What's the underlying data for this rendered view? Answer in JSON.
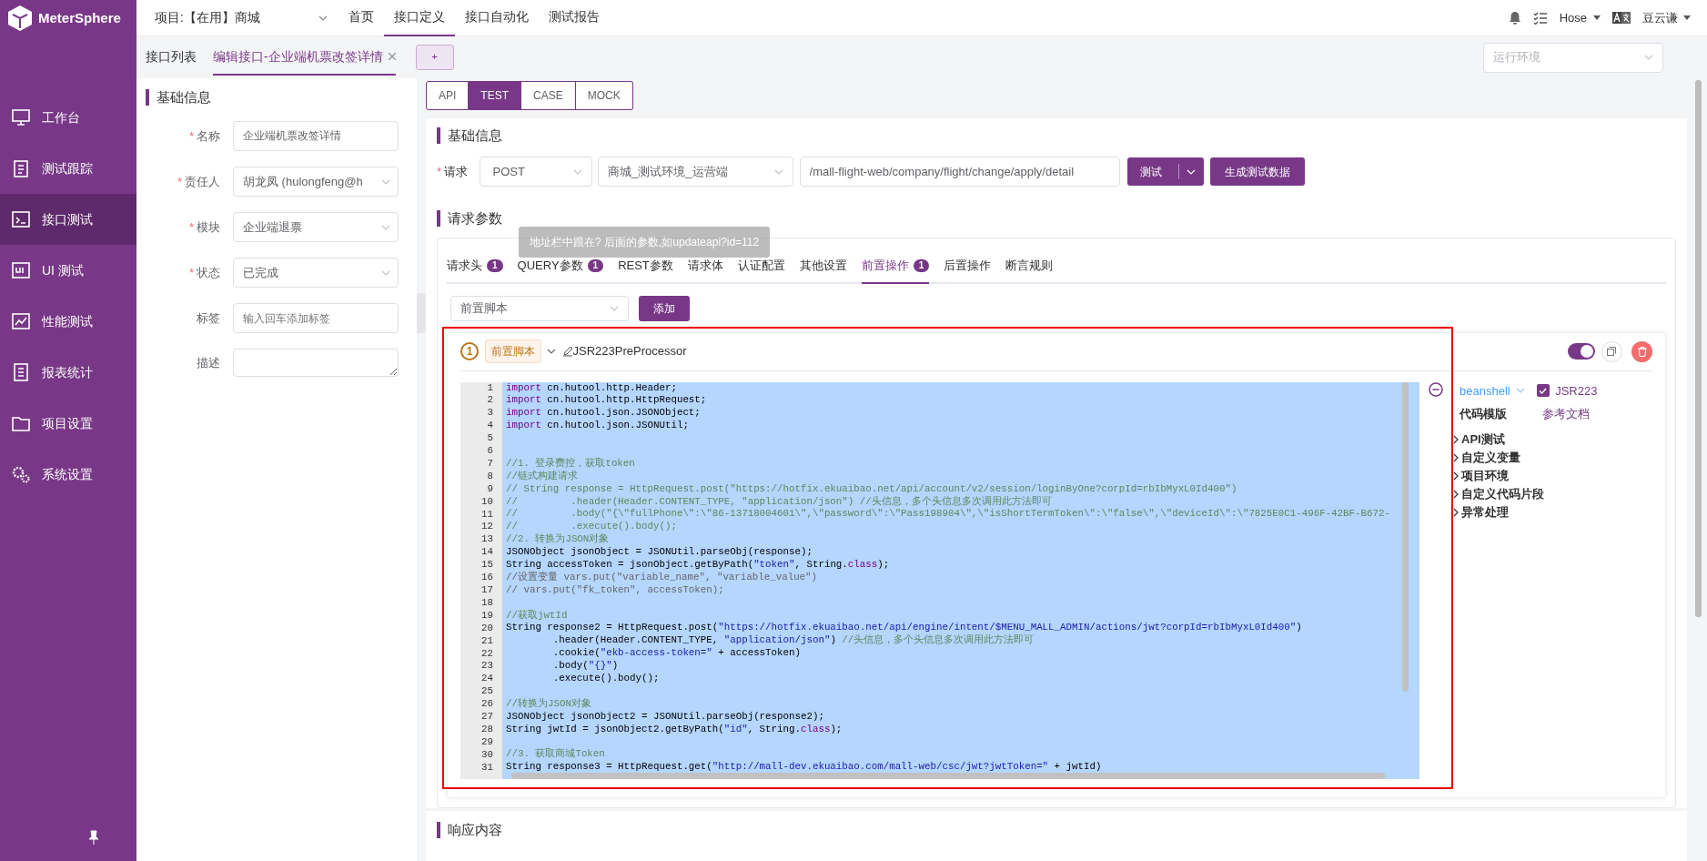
{
  "brand": "MeterSphere",
  "sidebar": {
    "items": [
      {
        "label": "工作台",
        "selected": false
      },
      {
        "label": "测试跟踪",
        "selected": false
      },
      {
        "label": "接口测试",
        "selected": true
      },
      {
        "label": "UI 测试",
        "selected": false
      },
      {
        "label": "性能测试",
        "selected": false
      },
      {
        "label": "报表统计",
        "selected": false
      },
      {
        "label": "项目设置",
        "selected": false
      },
      {
        "label": "系统设置",
        "selected": false
      }
    ]
  },
  "topbar": {
    "project": "项目:【在用】商城",
    "nav": [
      {
        "label": "首页",
        "selected": false
      },
      {
        "label": "接口定义",
        "selected": true
      },
      {
        "label": "接口自动化",
        "selected": false
      },
      {
        "label": "测试报告",
        "selected": false
      }
    ],
    "workspace": "Hose",
    "user": "豆云谦"
  },
  "tabs": [
    {
      "label": "接口列表",
      "selected": false,
      "closable": false
    },
    {
      "label": "编辑接口-企业端机票改签详情",
      "selected": true,
      "closable": true
    }
  ],
  "add_tab": "+",
  "environment": {
    "placeholder": "运行环境"
  },
  "basic_info": {
    "title": "基础信息",
    "fields": [
      {
        "label": "名称",
        "required_mark": "*",
        "kind": "input",
        "value": "企业端机票改签详情"
      },
      {
        "label": "责任人",
        "required_mark": "*",
        "kind": "select",
        "value": "胡龙凤 (hulongfeng@h"
      },
      {
        "label": "模块",
        "required_mark": "*",
        "kind": "select",
        "value": "企业端退票"
      },
      {
        "label": "状态",
        "required_mark": "*",
        "kind": "select",
        "value": "已完成"
      },
      {
        "label": "标签",
        "kind": "input",
        "placeholder": "输入回车添加标签"
      },
      {
        "label": "描述",
        "kind": "textarea"
      }
    ]
  },
  "mode_tabs": [
    {
      "label": "API",
      "selected": false
    },
    {
      "label": "TEST",
      "selected": true
    },
    {
      "label": "CASE",
      "selected": false
    },
    {
      "label": "MOCK",
      "selected": false
    }
  ],
  "request": {
    "title": "基础信息",
    "label": "请求",
    "required_mark": "*",
    "method": "POST",
    "environment": "商城_测试环境_运营端",
    "url": "/mall-flight-web/company/flight/change/apply/detail",
    "test_button": "测试",
    "generate_button": "生成测试数据"
  },
  "params": {
    "title": "请求参数",
    "tooltip": "地址栏中跟在? 后面的参数,如updateapi?id=112",
    "tabs": [
      {
        "label": "请求头",
        "badge": "1",
        "selected": false
      },
      {
        "label": "QUERY参数",
        "badge": "1",
        "selected": false
      },
      {
        "label": "REST参数",
        "selected": false
      },
      {
        "label": "请求体",
        "selected": false
      },
      {
        "label": "认证配置",
        "selected": false
      },
      {
        "label": "其他设置",
        "selected": false
      },
      {
        "label": "前置操作",
        "badge": "1",
        "selected": true
      },
      {
        "label": "后置操作",
        "selected": false
      },
      {
        "label": "断言规则",
        "selected": false
      }
    ],
    "script_select": "前置脚本",
    "add_button": "添加"
  },
  "processor": {
    "index": "1",
    "tag": "前置脚本",
    "name": "JSR223PreProcessor",
    "enabled": true,
    "code_lines": [
      {
        "no": "1",
        "segments": [
          {
            "kind": "kw",
            "text": "import"
          },
          {
            "kind": "plain",
            "text": " cn.hutool.http.Header;"
          }
        ]
      },
      {
        "no": "2",
        "segments": [
          {
            "kind": "kw",
            "text": "import"
          },
          {
            "kind": "plain",
            "text": " cn.hutool.http.HttpRequest;"
          }
        ]
      },
      {
        "no": "3",
        "segments": [
          {
            "kind": "kw",
            "text": "import"
          },
          {
            "kind": "plain",
            "text": " cn.hutool.json.JSONObject;"
          }
        ]
      },
      {
        "no": "4",
        "segments": [
          {
            "kind": "kw",
            "text": "import"
          },
          {
            "kind": "plain",
            "text": " cn.hutool.json.JSONUtil;"
          }
        ]
      },
      {
        "no": "5"
      },
      {
        "no": "6"
      },
      {
        "no": "7",
        "segments": [
          {
            "kind": "cmt",
            "text": "//1. 登录费控，获取token"
          }
        ]
      },
      {
        "no": "8",
        "segments": [
          {
            "kind": "cmt",
            "text": "//链式构建请求"
          }
        ]
      },
      {
        "no": "9",
        "segments": [
          {
            "kind": "cmt",
            "text": "// String response = HttpRequest.post(\"https://hotfix.ekuaibao.net/api/account/v2/session/loginByOne?corpId=rbIbMyxL0Id400\")"
          }
        ]
      },
      {
        "no": "10",
        "segments": [
          {
            "kind": "cmt",
            "text": "//         .header(Header.CONTENT_TYPE, \"application/json\") //头信息，多个头信息多次调用此方法即可"
          }
        ]
      },
      {
        "no": "11",
        "segments": [
          {
            "kind": "cmt",
            "text": "//         .body(\"{\\\"fullPhone\\\":\\\"86-13718004601\\\",\\\"password\\\":\\\"Pass198904\\\",\\\"isShortTermToken\\\":\\\"false\\\",\\\"deviceId\\\":\\\"7825E0C1-496F-42BF-B672-"
          }
        ]
      },
      {
        "no": "12",
        "segments": [
          {
            "kind": "cmt",
            "text": "//         .execute().body();"
          }
        ]
      },
      {
        "no": "13",
        "segments": [
          {
            "kind": "cmt",
            "text": "//2. 转换为JSON对象"
          }
        ]
      },
      {
        "no": "14",
        "segments": [
          {
            "kind": "plain",
            "text": "JSONObject jsonObject = JSONUtil.parseObj(response);"
          }
        ]
      },
      {
        "no": "15",
        "segments": [
          {
            "kind": "plain",
            "text": "String accessToken = jsonObject.getByPath("
          },
          {
            "kind": "str",
            "text": "\"token\""
          },
          {
            "kind": "plain",
            "text": ", String."
          },
          {
            "kind": "kw",
            "text": "class"
          },
          {
            "kind": "plain",
            "text": ");"
          }
        ]
      },
      {
        "no": "16",
        "segments": [
          {
            "kind": "cmt2",
            "text": "//设置变量 vars.put(\"variable_name\", \"variable_value\")"
          }
        ]
      },
      {
        "no": "17",
        "segments": [
          {
            "kind": "cmt2",
            "text": "// vars.put(\"fk_token\", accessToken);"
          }
        ]
      },
      {
        "no": "18"
      },
      {
        "no": "19",
        "segments": [
          {
            "kind": "cmt",
            "text": "//获取jwtId"
          }
        ]
      },
      {
        "no": "20",
        "segments": [
          {
            "kind": "plain",
            "text": "String response2 = HttpRequest.post("
          },
          {
            "kind": "str",
            "text": "\"https://hotfix.ekuaibao.net/api/engine/intent/$MENU_MALL_ADMIN/actions/jwt?corpId=rbIbMyxL0Id400\""
          },
          {
            "kind": "plain",
            "text": ")"
          }
        ]
      },
      {
        "no": "21",
        "segments": [
          {
            "kind": "plain",
            "text": "        .header(Header.CONTENT_TYPE, "
          },
          {
            "kind": "str",
            "text": "\"application/json\""
          },
          {
            "kind": "plain",
            "text": ") "
          },
          {
            "kind": "cmt",
            "text": "//头信息，多个头信息多次调用此方法即可"
          }
        ]
      },
      {
        "no": "22",
        "segments": [
          {
            "kind": "plain",
            "text": "        .cookie("
          },
          {
            "kind": "str",
            "text": "\"ekb-access-token=\""
          },
          {
            "kind": "plain",
            "text": " + accessToken)"
          }
        ]
      },
      {
        "no": "23",
        "segments": [
          {
            "kind": "plain",
            "text": "        .body("
          },
          {
            "kind": "str",
            "text": "\"{}\""
          },
          {
            "kind": "plain",
            "text": ")"
          }
        ]
      },
      {
        "no": "24",
        "segments": [
          {
            "kind": "plain",
            "text": "        .execute().body();"
          }
        ]
      },
      {
        "no": "25"
      },
      {
        "no": "26",
        "segments": [
          {
            "kind": "cmt",
            "text": "//转换为JSON对象"
          }
        ]
      },
      {
        "no": "27",
        "segments": [
          {
            "kind": "plain",
            "text": "JSONObject jsonObject2 = JSONUtil.parseObj(response2);"
          }
        ]
      },
      {
        "no": "28",
        "segments": [
          {
            "kind": "plain",
            "text": "String jwtId = jsonObject2.getByPath("
          },
          {
            "kind": "str",
            "text": "\"id\""
          },
          {
            "kind": "plain",
            "text": ", String."
          },
          {
            "kind": "kw",
            "text": "class"
          },
          {
            "kind": "plain",
            "text": ");"
          }
        ]
      },
      {
        "no": "29"
      },
      {
        "no": "30",
        "segments": [
          {
            "kind": "cmt",
            "text": "//3. 获取商城Token"
          }
        ]
      },
      {
        "no": "31",
        "segments": [
          {
            "kind": "plain",
            "text": "String response3 = HttpRequest.get("
          },
          {
            "kind": "str",
            "text": "\"http://mall-dev.ekuaibao.com/mall-web/csc/jwt?jwtToken=\""
          },
          {
            "kind": "plain",
            "text": " + jwtId)"
          }
        ]
      }
    ],
    "language": "beanshell",
    "jsr223_checked": true,
    "jsr223_label": "JSR223",
    "template_title": "代码模版",
    "docs_link": "参考文档",
    "template_groups": [
      {
        "label": "API测试",
        "expanded": false
      },
      {
        "label": "自定义变量",
        "expanded": false
      },
      {
        "label": "项目环境",
        "expanded": false
      },
      {
        "label": "自定义代码片段",
        "expanded": false
      },
      {
        "label": "异常处理",
        "expanded": false
      }
    ]
  },
  "response": {
    "title": "响应内容"
  }
}
